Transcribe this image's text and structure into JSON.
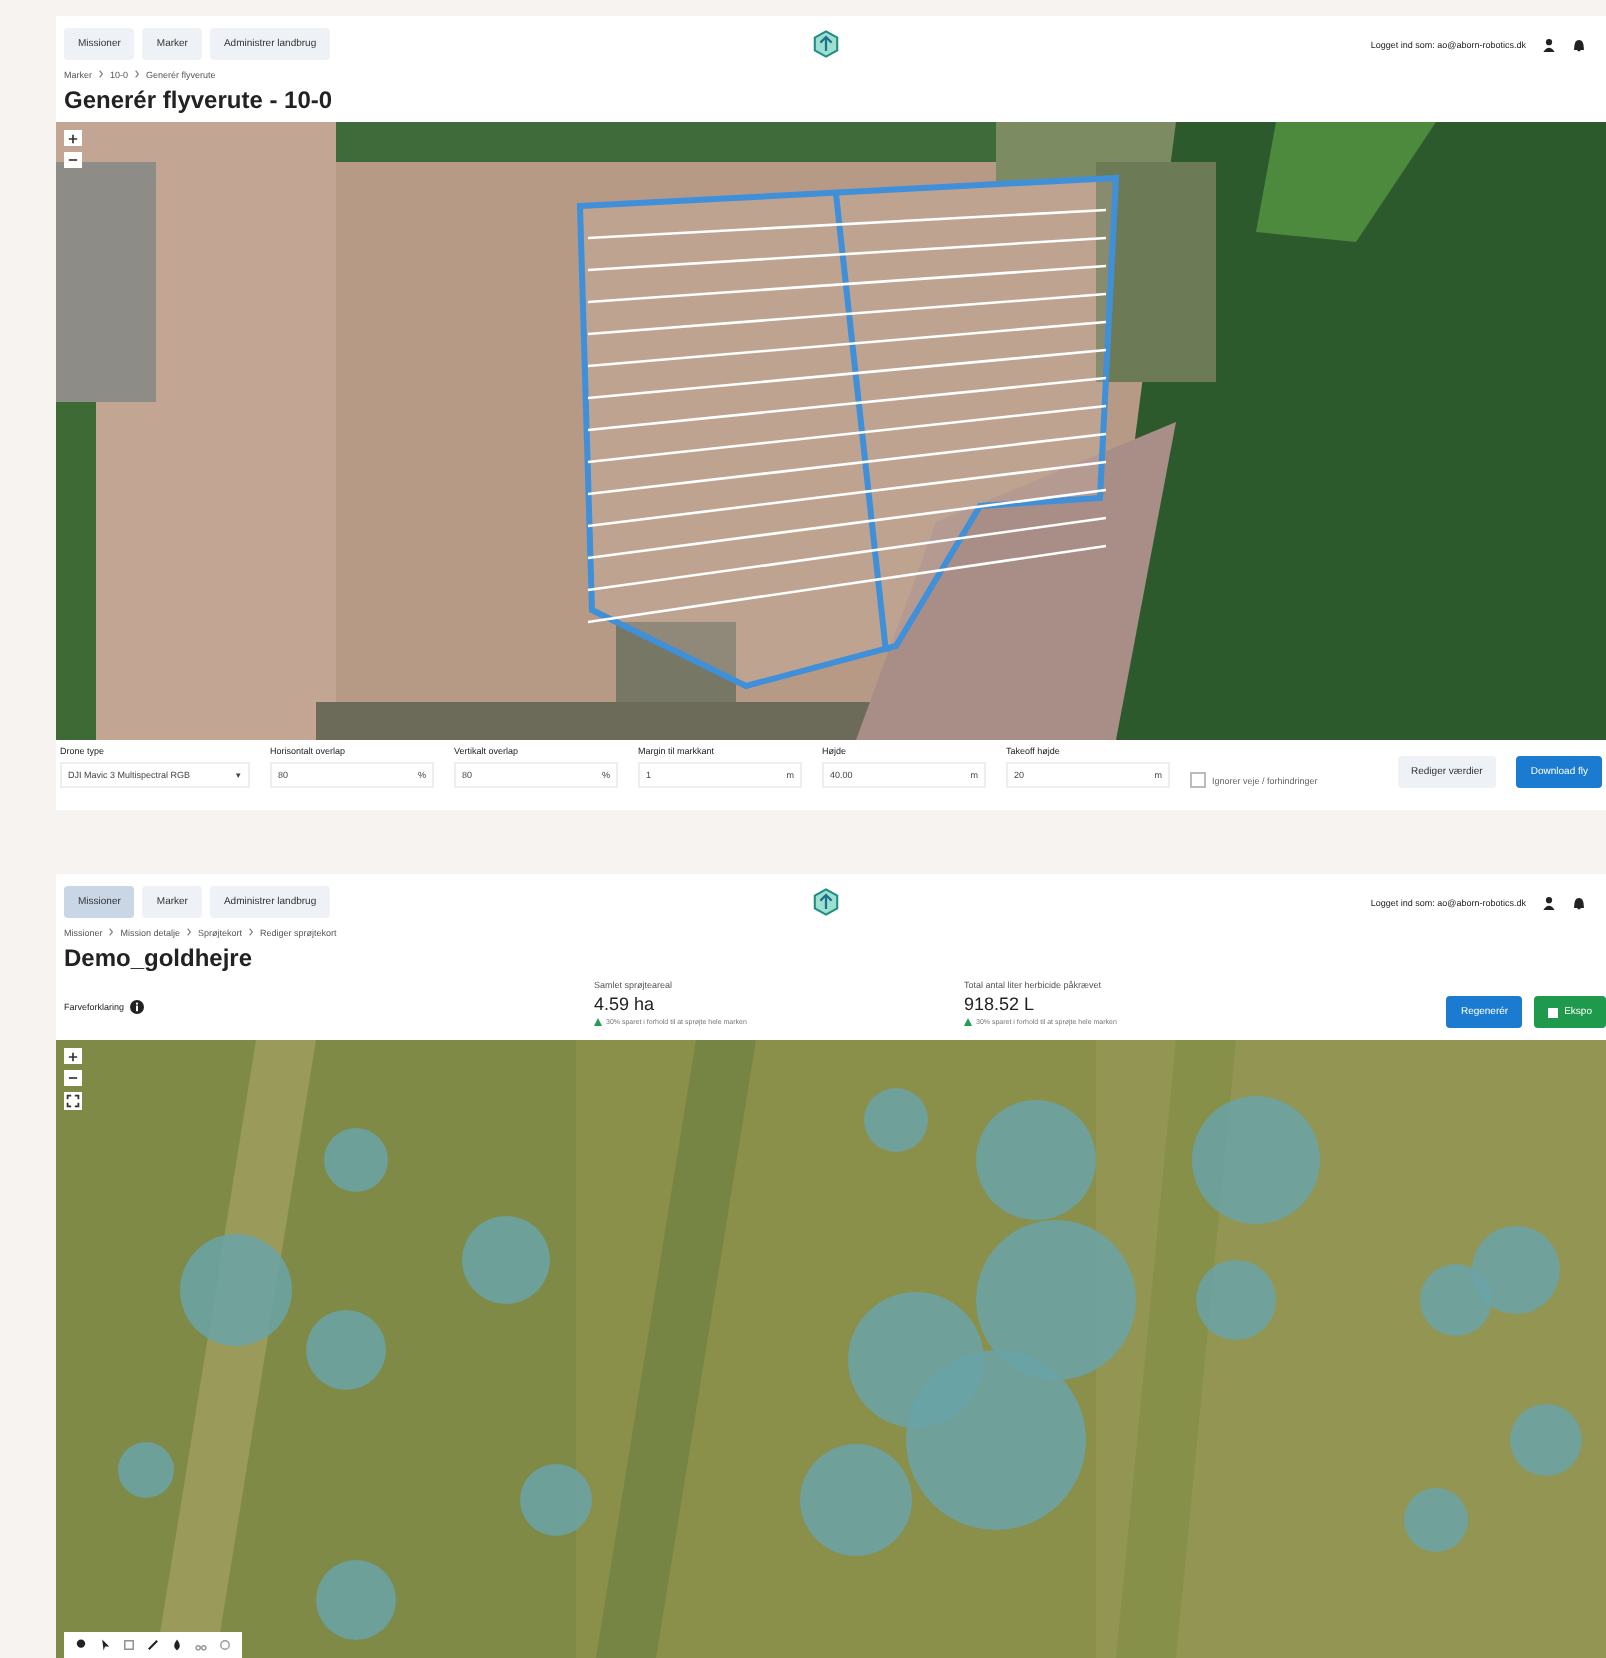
{
  "route_screen": {
    "nav": [
      {
        "label": "Missioner",
        "selected": false
      },
      {
        "label": "Marker",
        "selected": false
      },
      {
        "label": "Administrer landbrug",
        "selected": false
      }
    ],
    "user": "Logget ind som: ao@aborn-robotics.dk",
    "breadcrumb": [
      "Marker",
      "10-0",
      "Generér flyverute"
    ],
    "title": "Generér flyverute - 10-0",
    "fields": [
      {
        "label": "Drone type",
        "value": "DJI Mavic 3 Multispectral RGB",
        "unit": "▾"
      },
      {
        "label": "Horisontalt overlap",
        "value": "80",
        "unit": "%"
      },
      {
        "label": "Vertikalt overlap",
        "value": "80",
        "unit": "%"
      },
      {
        "label": "Margin til markkant",
        "value": "1",
        "unit": "m"
      },
      {
        "label": "Højde",
        "value": "40.00",
        "unit": "m"
      },
      {
        "label": "Takeoff højde",
        "value": "20",
        "unit": "m"
      }
    ],
    "ignore": {
      "label": "Ignorer veje / forhindringer",
      "checked": false
    },
    "buttons": [
      "Rediger værdier",
      "Download fly"
    ]
  },
  "spray_screen": {
    "nav": [
      {
        "label": "Missioner",
        "selected": true
      },
      {
        "label": "Marker",
        "selected": false
      },
      {
        "label": "Administrer landbrug",
        "selected": false
      }
    ],
    "user": "Logget ind som: ao@aborn-robotics.dk",
    "breadcrumb": [
      "Missioner",
      "Mission detalje",
      "Sprøjtekort",
      "Rediger sprøjtekort"
    ],
    "title": "Demo_goldhejre",
    "legend": "Farveforklaring",
    "stats": [
      {
        "label": "Samlet sprøjteareal",
        "value": "4.59 ha",
        "note": "30% sparet i forhold til at sprøjte hele marken"
      },
      {
        "label": "Total antal liter herbicide påkrævet",
        "value": "918.52 L",
        "note": "30% sparet i forhold til at sprøjte hele marken"
      }
    ],
    "buttons": [
      "Regenerér",
      "Ekspo"
    ]
  }
}
